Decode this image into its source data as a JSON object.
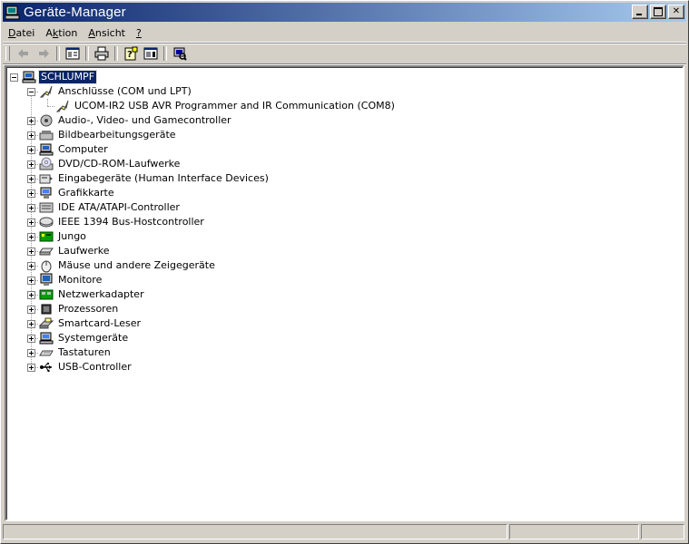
{
  "window": {
    "title": "Geräte-Manager"
  },
  "menu": [
    {
      "label": "Datei",
      "accel_index": 0
    },
    {
      "label": "Aktion",
      "accel_index": 1
    },
    {
      "label": "Ansicht",
      "accel_index": 0
    },
    {
      "label": "?",
      "accel_index": 0
    }
  ],
  "toolbar": {
    "buttons": [
      "back-arrow-icon",
      "forward-arrow-icon",
      "console-tree-icon",
      "print-icon",
      "properties-icon",
      "help-icon",
      "scan-hardware-icon"
    ]
  },
  "tree": {
    "root": "SCHLUMPF",
    "expanded_category": "Anschlüsse (COM und LPT)",
    "expanded_child": "UCOM-IR2 USB AVR Programmer and IR Communication (COM8)",
    "categories": [
      "Audio-, Video- und Gamecontroller",
      "Bildbearbeitungsgeräte",
      "Computer",
      "DVD/CD-ROM-Laufwerke",
      "Eingabegeräte (Human Interface Devices)",
      "Grafikkarte",
      "IDE ATA/ATAPI-Controller",
      "IEEE 1394 Bus-Hostcontroller",
      "Jungo",
      "Laufwerke",
      "Mäuse und andere Zeigegeräte",
      "Monitore",
      "Netzwerkadapter",
      "Prozessoren",
      "Smartcard-Leser",
      "Systemgeräte",
      "Tastaturen",
      "USB-Controller"
    ]
  },
  "colors": {
    "titlebar_start": "#0a246a",
    "titlebar_end": "#a6caf0",
    "selection": "#0a246a",
    "face": "#d4d0c8"
  }
}
